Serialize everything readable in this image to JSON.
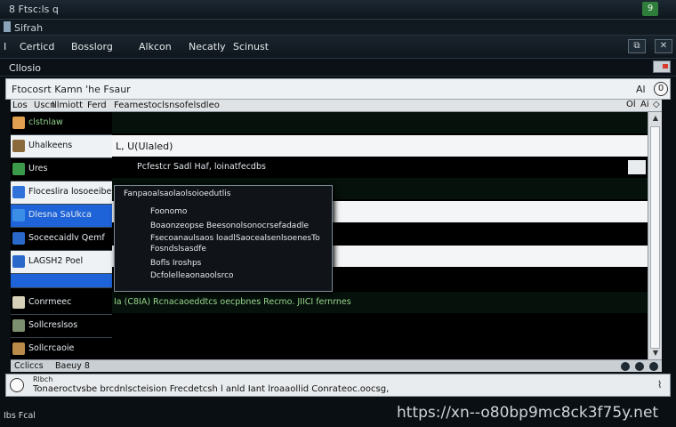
{
  "window": {
    "title": "8 Ftsc:ls q",
    "badge": "9"
  },
  "app": {
    "title": "Sifrah"
  },
  "menu": {
    "items": [
      "I",
      "Certicd",
      "Bosslorg",
      "Alkcon",
      "Necatly",
      "Scinust"
    ],
    "buttons": [
      "⧉",
      "✕"
    ]
  },
  "subtitle": {
    "text": "Cllosio"
  },
  "search": {
    "text": "Ftocosrt Kamn 'he Fsaur",
    "aa": "Al",
    "circle_label": "0"
  },
  "columns": {
    "headers": [
      "Los",
      "Uscn",
      "Illmiott",
      "Ferd",
      "Feamestoclsnsofelsdleo"
    ],
    "right": [
      "Ol",
      "Ai",
      "◇"
    ]
  },
  "sidebar": {
    "items": [
      {
        "label": "clstnlaw",
        "icon": "app-icon",
        "color": "#e0a050"
      },
      {
        "label": "Uhalkeens",
        "icon": "folder-icon",
        "color": "#8a6a3a"
      },
      {
        "label": "Ures",
        "icon": "user-icon",
        "color": "#3a9a4a"
      },
      {
        "label": "Floceslira losoeeibe",
        "icon": "monitor-icon",
        "color": "#2f72d9"
      },
      {
        "label": "Dlesna SaUkca",
        "icon": "gear-icon",
        "color": "#3b8ee8"
      },
      {
        "label": "Soceecaidlv Qemf",
        "icon": "list-icon",
        "color": "#2a68c9"
      },
      {
        "label": "LAGSH2 Poel",
        "icon": "folder-icon",
        "color": "#2a68c9"
      },
      {
        "label": "Conrmeec",
        "icon": "check-icon",
        "color": "#d6d0b8"
      },
      {
        "label": "Sollcreslsos",
        "icon": "doc-icon",
        "color": "#7c8f6e"
      },
      {
        "label": "Sollcrcaoie",
        "icon": "app-icon",
        "color": "#b98a4a"
      }
    ]
  },
  "content": {
    "rows": [
      {
        "text": "",
        "style": "dark"
      },
      {
        "text": "L, U(Ulaled)",
        "style": "white"
      },
      {
        "text": "Pcfestcr Sadl Haf, loinatfecdbs",
        "style": "black"
      },
      {
        "text": "",
        "style": "dark"
      },
      {
        "text": "",
        "style": "white"
      },
      {
        "text": "",
        "style": "black"
      },
      {
        "text": "",
        "style": "white"
      },
      {
        "text": "Ia  (C8IA) Rcnacaoeddtcs oecpbnes Recmo. JIICI fernrnes",
        "style": "dark"
      },
      {
        "text": "",
        "style": "black"
      },
      {
        "text": "",
        "style": "black"
      },
      {
        "text": "",
        "style": "black"
      }
    ]
  },
  "popup": {
    "lines": [
      "Fanpaoalsaolaolsoioedutlis",
      "Foonomo",
      "Boaonzeopse  Beesonolsonocrsefadadle",
      "Fsecoanaulsaos loadlSaocealsenlsoenesTo",
      "Fosndslsasdfe",
      "Bofls Iroshps",
      "Dcfolelleaonaoolsrco"
    ]
  },
  "status": {
    "left": "Ccliccs",
    "right": "Baeuy 8"
  },
  "find": {
    "label": "Rlbch",
    "text": "Tonaeroctvsbe  brcdnlscteision  Frecdetcsh l  anld  Iant  lroaaollid  Conrateoc.oocsg,",
    "end": "⌇"
  },
  "bottom": {
    "left": "Ibs Fcal",
    "watermark": "https://xn--o80bp9mc8ck3f75y.net"
  }
}
